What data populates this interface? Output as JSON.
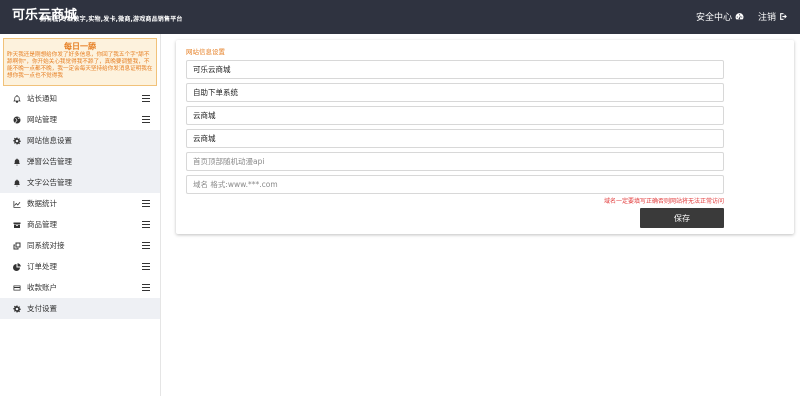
{
  "header": {
    "brand": "可乐云商城",
    "tagline": "拥有低,专业数字,实物,发卡,微商,游戏商品销售平台",
    "nav": {
      "security_center": "安全中心",
      "logout": "注销"
    }
  },
  "sidebar": {
    "notice": {
      "title": "每日一舔",
      "text": "昨天我还是刚想给你发了好多信息，你回了我五个字\"舔不舔啊你\"，你开始关心我觉得我不舔了，真晚要调整我，不能不晚一点都不晚，我一定会每天坚持给你发消息证明我在想你我一点也不觉得我"
    },
    "items": [
      {
        "label": "站长通知",
        "icon": "bell-icon",
        "expandable": true
      },
      {
        "label": "网站管理",
        "icon": "globe-icon",
        "expandable": true
      },
      {
        "label": "网站信息设置",
        "icon": "gear-icon",
        "expandable": false,
        "active": true
      },
      {
        "label": "弹窗公告管理",
        "icon": "bell-icon",
        "expandable": false,
        "active": true
      },
      {
        "label": "文字公告管理",
        "icon": "bell-icon",
        "expandable": false,
        "active": true
      },
      {
        "label": "数据统计",
        "icon": "line-chart-icon",
        "expandable": true
      },
      {
        "label": "商品管理",
        "icon": "box-icon",
        "expandable": true
      },
      {
        "label": "同系统对接",
        "icon": "clone-icon",
        "expandable": true
      },
      {
        "label": "订单处理",
        "icon": "pie-chart-icon",
        "expandable": true
      },
      {
        "label": "收款账户",
        "icon": "credit-card-icon",
        "expandable": true
      },
      {
        "label": "支付设置",
        "icon": "gear-icon",
        "expandable": false,
        "active": true
      }
    ]
  },
  "form": {
    "title": "网站信息设置",
    "site_name": {
      "value": "可乐云商城",
      "placeholder": ""
    },
    "site_subtitle": {
      "value": "自助下单系统",
      "placeholder": ""
    },
    "keywords": {
      "value": "云商城",
      "placeholder": ""
    },
    "description": {
      "value": "云商城",
      "placeholder": ""
    },
    "banner_api": {
      "value": "",
      "placeholder": "首页顶部随机动漫api"
    },
    "domain": {
      "value": "",
      "placeholder": "域名 格式:www.***.com"
    },
    "domain_warning": "域名一定要填写正确否则网站将无法正常访问",
    "save_label": "保存"
  },
  "colors": {
    "topbar": "#2f3340",
    "accent": "#e67e22",
    "warning": "#e23b3b",
    "save_button": "#3a3a3a"
  }
}
